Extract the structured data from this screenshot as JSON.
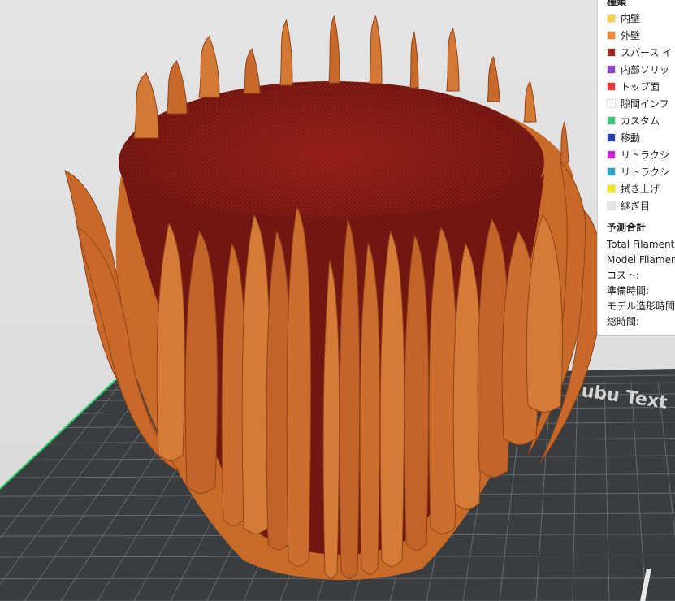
{
  "legend": {
    "heading": "種類",
    "items": [
      {
        "label": "内壁",
        "color": "#f5d34a",
        "icon": "color-swatch"
      },
      {
        "label": "外壁",
        "color": "#f08a3a",
        "icon": "color-swatch"
      },
      {
        "label": "スパース イ",
        "color": "#9b2a22",
        "icon": "color-swatch"
      },
      {
        "label": "内部ソリッ",
        "color": "#8e45c4",
        "icon": "color-swatch"
      },
      {
        "label": "トップ面",
        "color": "#e43a3a",
        "icon": "color-swatch"
      },
      {
        "label": "隙間インフ",
        "color": "#ffffff",
        "icon": "color-swatch"
      },
      {
        "label": "カスタム",
        "color": "#3fc67a",
        "icon": "color-swatch"
      },
      {
        "label": "移動",
        "color": "#2b3fb8",
        "icon": "color-swatch"
      },
      {
        "label": "リトラクシ",
        "color": "#c92ad1",
        "icon": "color-swatch"
      },
      {
        "label": "リトラクシ",
        "color": "#2fa7c4",
        "icon": "color-swatch"
      },
      {
        "label": "拭き上げ",
        "color": "#f2e81f",
        "icon": "color-swatch"
      },
      {
        "label": "継ぎ目",
        "color": "#e6e6e6",
        "icon": "color-swatch"
      }
    ]
  },
  "estimates": {
    "heading": "予測合計",
    "rows": [
      {
        "label": "Total Filament:"
      },
      {
        "label": "Model Filamen"
      },
      {
        "label": "コスト:"
      },
      {
        "label": "準備時間:"
      },
      {
        "label": "モデル造形時間"
      },
      {
        "label": "総時間:"
      }
    ]
  },
  "build_plate": {
    "logo_text": "ubu Text",
    "plate_color": "#3a3d40",
    "grid_color": "#6a6e71",
    "edge_color": "#2ecf6a"
  },
  "model": {
    "wall_color": "#c86a28",
    "infill_color": "#7d1712"
  }
}
